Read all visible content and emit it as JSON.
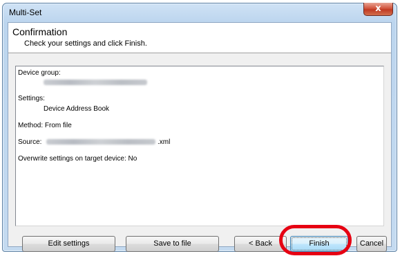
{
  "window": {
    "title": "Multi-Set",
    "close_glyph": "x"
  },
  "header": {
    "title": "Confirmation",
    "subtitle": "Check your settings and click Finish."
  },
  "summary": {
    "device_group_label": "Device group:",
    "settings_label": "Settings:",
    "settings_value": "Device Address Book",
    "method": "Method: From file",
    "source_label": "Source:",
    "source_suffix": ".xml",
    "overwrite": "Overwrite settings on target device: No"
  },
  "buttons": {
    "edit_settings": "Edit settings",
    "save_to_file": "Save to file",
    "back": "< Back",
    "finish": "Finish",
    "cancel": "Cancel"
  },
  "colors": {
    "highlight": "#e60012",
    "close_button": "#c8442c"
  },
  "icons": {
    "close": "close-icon"
  }
}
